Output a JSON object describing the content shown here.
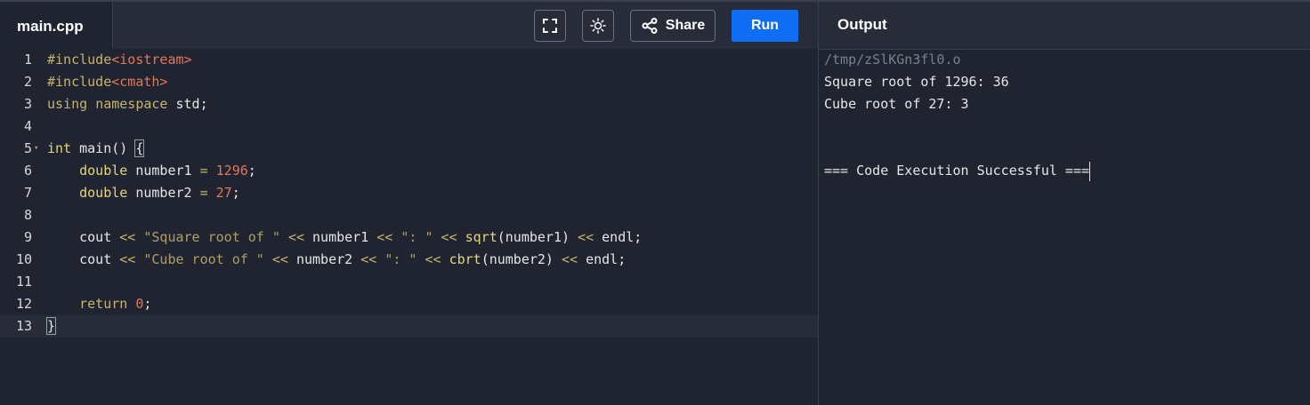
{
  "header": {
    "file_tab": "main.cpp",
    "buttons": {
      "fullscreen_icon": "fullscreen-icon",
      "theme_icon": "sun-icon",
      "share_label": "Share",
      "run_label": "Run"
    },
    "output_title": "Output"
  },
  "editor": {
    "line_numbers": [
      "1",
      "2",
      "3",
      "4",
      "5",
      "6",
      "7",
      "8",
      "9",
      "10",
      "11",
      "12",
      "13"
    ],
    "lines": [
      [
        {
          "t": "pp",
          "v": "#include"
        },
        {
          "t": "inc",
          "v": "<iostream>"
        }
      ],
      [
        {
          "t": "pp",
          "v": "#include"
        },
        {
          "t": "inc",
          "v": "<cmath>"
        }
      ],
      [
        {
          "t": "kw",
          "v": "using"
        },
        {
          "t": "plain",
          "v": " "
        },
        {
          "t": "kw",
          "v": "namespace"
        },
        {
          "t": "plain",
          "v": " std;"
        }
      ],
      [],
      [
        {
          "t": "type",
          "v": "int"
        },
        {
          "t": "plain",
          "v": " main() "
        },
        {
          "t": "brace",
          "v": "{"
        }
      ],
      [
        {
          "t": "plain",
          "v": "    "
        },
        {
          "t": "type",
          "v": "double"
        },
        {
          "t": "plain",
          "v": " number1 "
        },
        {
          "t": "op",
          "v": "="
        },
        {
          "t": "plain",
          "v": " "
        },
        {
          "t": "num",
          "v": "1296"
        },
        {
          "t": "plain",
          "v": ";"
        }
      ],
      [
        {
          "t": "plain",
          "v": "    "
        },
        {
          "t": "type",
          "v": "double"
        },
        {
          "t": "plain",
          "v": " number2 "
        },
        {
          "t": "op",
          "v": "="
        },
        {
          "t": "plain",
          "v": " "
        },
        {
          "t": "num",
          "v": "27"
        },
        {
          "t": "plain",
          "v": ";"
        }
      ],
      [],
      [
        {
          "t": "plain",
          "v": "    cout "
        },
        {
          "t": "op",
          "v": "<<"
        },
        {
          "t": "plain",
          "v": " "
        },
        {
          "t": "str",
          "v": "\"Square root of \""
        },
        {
          "t": "plain",
          "v": " "
        },
        {
          "t": "op",
          "v": "<<"
        },
        {
          "t": "plain",
          "v": " number1 "
        },
        {
          "t": "op",
          "v": "<<"
        },
        {
          "t": "plain",
          "v": " "
        },
        {
          "t": "str",
          "v": "\": \""
        },
        {
          "t": "plain",
          "v": " "
        },
        {
          "t": "op",
          "v": "<<"
        },
        {
          "t": "plain",
          "v": " "
        },
        {
          "t": "fn",
          "v": "sqrt"
        },
        {
          "t": "plain",
          "v": "(number1) "
        },
        {
          "t": "op",
          "v": "<<"
        },
        {
          "t": "plain",
          "v": " endl;"
        }
      ],
      [
        {
          "t": "plain",
          "v": "    cout "
        },
        {
          "t": "op",
          "v": "<<"
        },
        {
          "t": "plain",
          "v": " "
        },
        {
          "t": "str",
          "v": "\"Cube root of \""
        },
        {
          "t": "plain",
          "v": " "
        },
        {
          "t": "op",
          "v": "<<"
        },
        {
          "t": "plain",
          "v": " number2 "
        },
        {
          "t": "op",
          "v": "<<"
        },
        {
          "t": "plain",
          "v": " "
        },
        {
          "t": "str",
          "v": "\": \""
        },
        {
          "t": "plain",
          "v": " "
        },
        {
          "t": "op",
          "v": "<<"
        },
        {
          "t": "plain",
          "v": " "
        },
        {
          "t": "fn",
          "v": "cbrt"
        },
        {
          "t": "plain",
          "v": "(number2) "
        },
        {
          "t": "op",
          "v": "<<"
        },
        {
          "t": "plain",
          "v": " endl;"
        }
      ],
      [],
      [
        {
          "t": "plain",
          "v": "    "
        },
        {
          "t": "kw",
          "v": "return"
        },
        {
          "t": "plain",
          "v": " "
        },
        {
          "t": "num",
          "v": "0"
        },
        {
          "t": "plain",
          "v": ";"
        }
      ],
      [
        {
          "t": "brace",
          "v": "}"
        }
      ]
    ],
    "fold_line": 5,
    "active_line": 13
  },
  "output": {
    "lines": [
      {
        "text": "/tmp/zSlKGn3fl0.o",
        "style": "dim"
      },
      {
        "text": "Square root of 1296: 36",
        "style": "normal"
      },
      {
        "text": "Cube root of 27: 3",
        "style": "normal"
      },
      {
        "text": "",
        "style": "normal"
      },
      {
        "text": "",
        "style": "normal"
      },
      {
        "text": "=== Code Execution Successful ===",
        "style": "normal"
      }
    ]
  },
  "colors": {
    "accent_run": "#0f6ef5",
    "background": "#1f2430",
    "topbar": "#272c38"
  }
}
